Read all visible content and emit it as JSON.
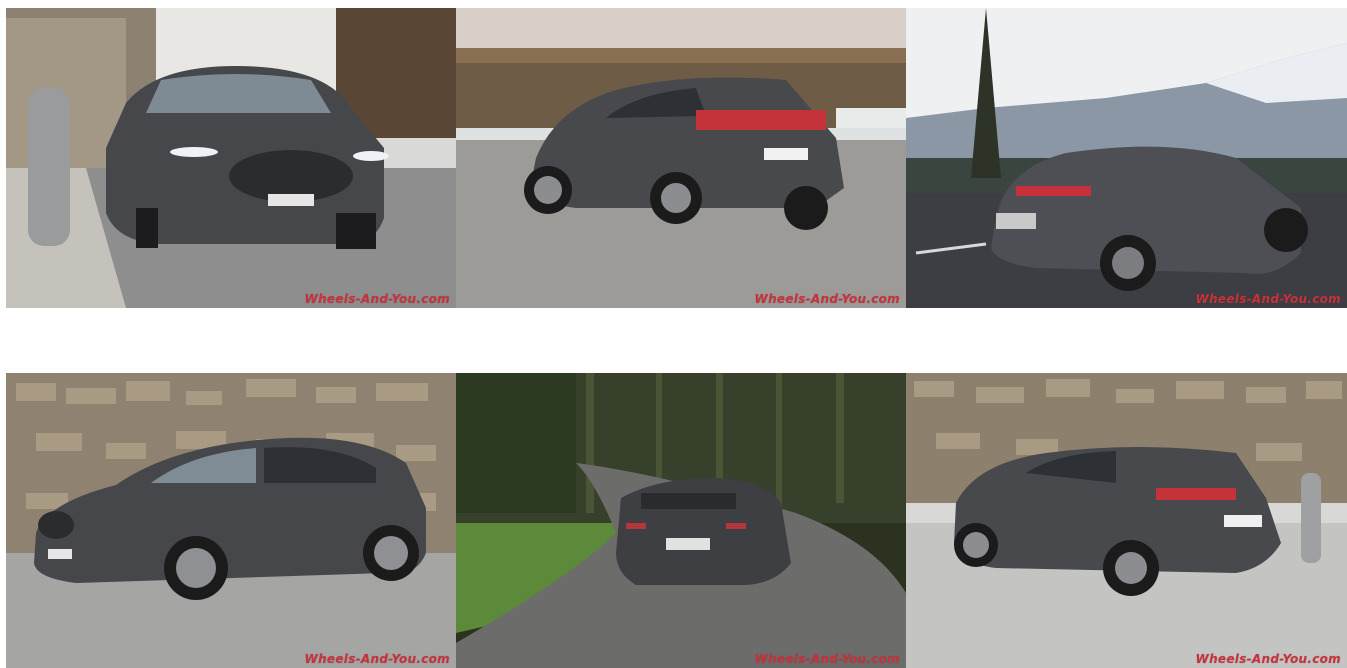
{
  "gallery": {
    "photos": [
      {
        "alt": "Mazda CX-30 front view in front of stone wall",
        "watermark": "Wheels-And-You.com"
      },
      {
        "alt": "Mazda CX-30 rear three-quarter view",
        "watermark": "Wheels-And-You.com"
      },
      {
        "alt": "Mazda CX-30 rear view near mountains",
        "watermark": "Wheels-And-You.com"
      },
      {
        "alt": "Mazda CX-30 side profile in front of stone wall",
        "watermark": "Wheels-And-You.com"
      },
      {
        "alt": "Mazda CX-30 driving on forest road",
        "watermark": "Wheels-And-You.com"
      },
      {
        "alt": "Mazda CX-30 rear three-quarter in front of stone wall",
        "watermark": "Wheels-And-You.com"
      }
    ]
  },
  "colors": {
    "background": "#ffffff",
    "watermark": "#c9323c",
    "car_body": "#4a4b4f"
  }
}
